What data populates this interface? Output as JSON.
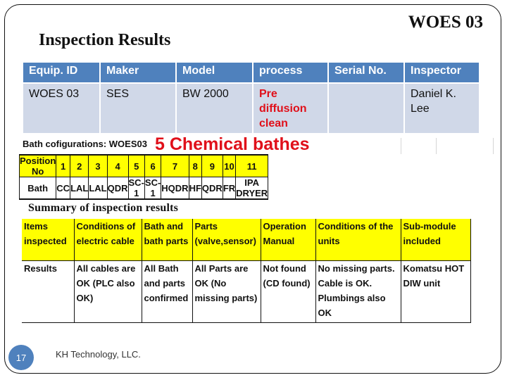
{
  "header": {
    "doc_id": "WOES 03",
    "title": "Inspection Results"
  },
  "info_table": {
    "columns": [
      "Equip. ID",
      "Maker",
      "Model",
      "process",
      "Serial No.",
      "Inspector"
    ],
    "row": {
      "equip_id": "WOES 03",
      "maker": "SES",
      "model": "BW 2000",
      "process": "Pre diffusion clean",
      "serial_no": "",
      "inspector": "Daniel K. Lee"
    }
  },
  "bath_config": {
    "caption": "Bath cofigurations: WOES03",
    "highlight": "5 Chemical bathes",
    "position_label": "Position No",
    "bath_label": "Bath",
    "positions": [
      "1",
      "2",
      "3",
      "4",
      "5",
      "6",
      "7",
      "8",
      "9",
      "10",
      "11"
    ],
    "baths": [
      "CC",
      "LAL",
      "LAL",
      "QDR",
      "SC-1",
      "SC-1",
      "HQDR",
      "HF",
      "QDR",
      "FR",
      "IPA DRYER"
    ]
  },
  "summary": {
    "title": "Summary of inspection results",
    "headers": [
      "Items inspected",
      "Conditions of electric cable",
      "Bath and bath parts",
      "Parts (valve,sensor)",
      "Operation Manual",
      "Conditions of the units",
      "Sub-module included"
    ],
    "results": [
      "Results",
      "All cables are OK (PLC also OK)",
      "All Bath and parts confirmed",
      "All Parts are OK (No missing parts)",
      "Not found (CD found)",
      "No missing parts. Cable is OK. Plumbings also OK",
      "Komatsu HOT DIW unit"
    ]
  },
  "footer": {
    "page_number": "17",
    "company": "KH Technology, LLC."
  },
  "colors": {
    "header_blue": "#4f81bd",
    "body_blue": "#d0d8e8",
    "highlight_red": "#e0101a",
    "yellow": "#ffff00"
  }
}
